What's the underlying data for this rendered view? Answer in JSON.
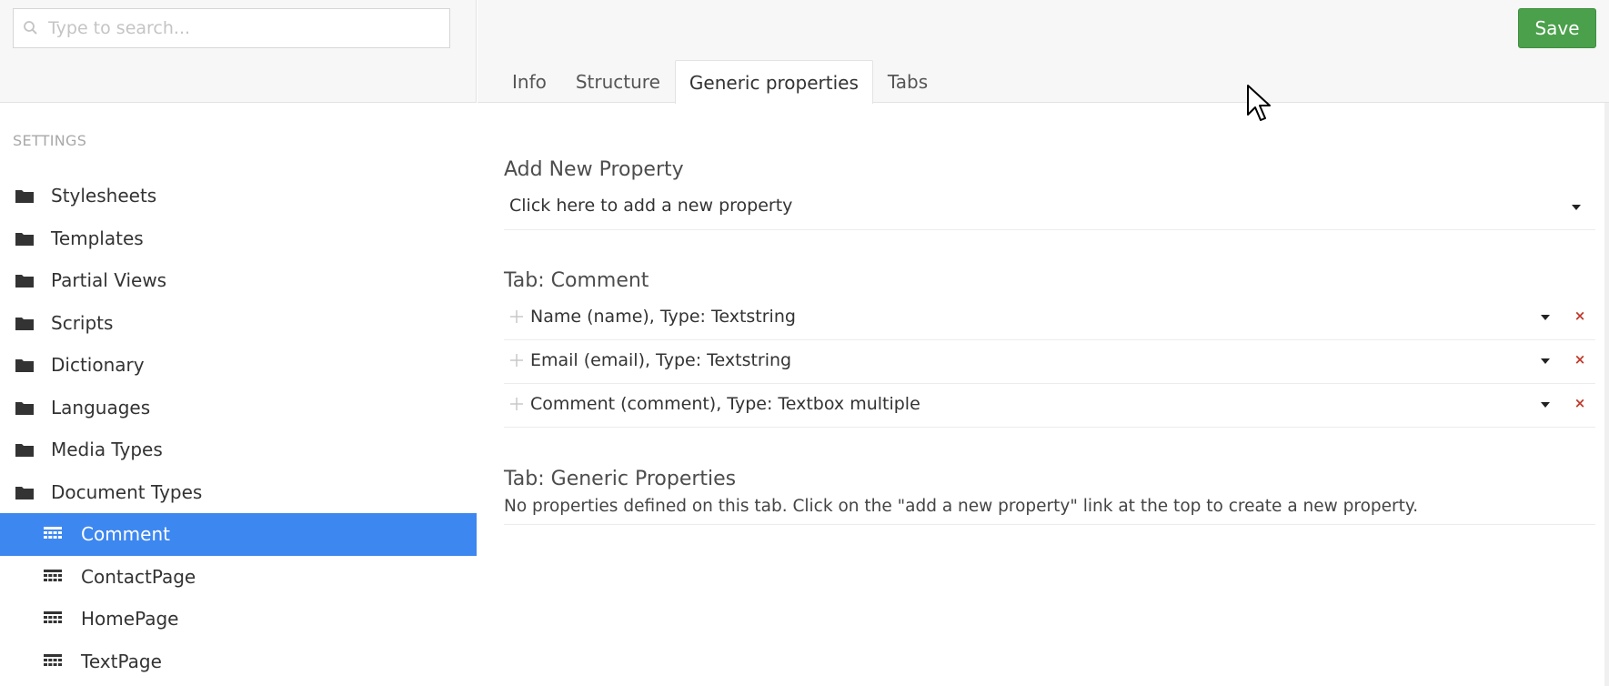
{
  "search": {
    "placeholder": "Type to search..."
  },
  "sidebar": {
    "section_title": "SETTINGS",
    "items": [
      {
        "label": "Stylesheets",
        "icon": "folder-icon"
      },
      {
        "label": "Templates",
        "icon": "folder-icon"
      },
      {
        "label": "Partial Views",
        "icon": "folder-icon"
      },
      {
        "label": "Scripts",
        "icon": "folder-icon"
      },
      {
        "label": "Dictionary",
        "icon": "folder-icon"
      },
      {
        "label": "Languages",
        "icon": "folder-icon"
      },
      {
        "label": "Media Types",
        "icon": "folder-icon"
      },
      {
        "label": "Document Types",
        "icon": "folder-icon"
      }
    ],
    "children": [
      {
        "label": "Comment",
        "icon": "document-type-icon",
        "active": true
      },
      {
        "label": "ContactPage",
        "icon": "document-type-icon"
      },
      {
        "label": "HomePage",
        "icon": "document-type-icon"
      },
      {
        "label": "TextPage",
        "icon": "document-type-icon"
      }
    ]
  },
  "toolbar": {
    "save_label": "Save"
  },
  "tabs": [
    {
      "label": "Info"
    },
    {
      "label": "Structure"
    },
    {
      "label": "Generic properties",
      "active": true
    },
    {
      "label": "Tabs"
    }
  ],
  "add_property": {
    "heading": "Add New Property",
    "dropdown_text": "Click here to add a new property"
  },
  "tab_comment": {
    "heading": "Tab: Comment",
    "properties": [
      {
        "text": "Name (name), Type: Textstring",
        "delete": "×"
      },
      {
        "text": "Email (email), Type: Textstring",
        "delete": "×"
      },
      {
        "text": "Comment (comment), Type: Textbox multiple",
        "delete": "×"
      }
    ]
  },
  "tab_generic": {
    "heading": "Tab: Generic Properties",
    "empty_message": "No properties defined on this tab. Click on the \"add a new property\" link at the top to create a new property."
  },
  "colors": {
    "accent_active": "#3d87f0",
    "save_button": "#4ba04b",
    "delete_icon": "#c0392b"
  }
}
